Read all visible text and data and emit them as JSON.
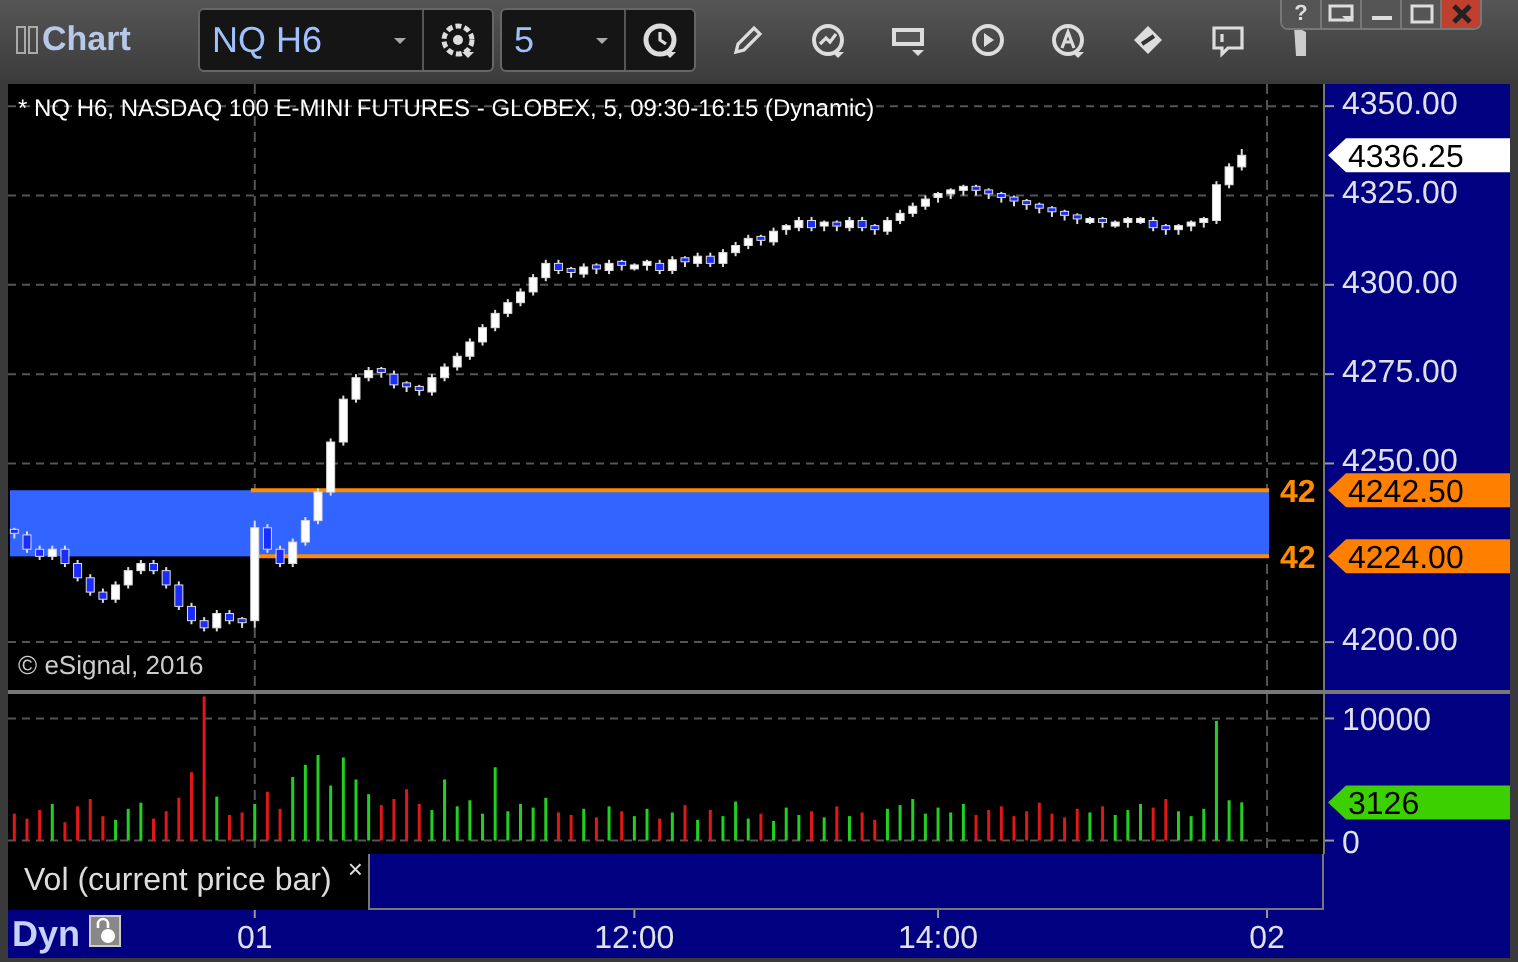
{
  "window": {
    "title": "Chart",
    "help_button": "?"
  },
  "toolbar": {
    "symbol": "NQ H6",
    "interval": "5"
  },
  "price_pane": {
    "title": "* NQ H6, NASDAQ 100 E-MINI FUTURES - GLOBEX, 5, 09:30-16:15 (Dynamic)",
    "copyright": "© eSignal, 2016",
    "last_price": "4336.25",
    "levels": [
      {
        "label": "42",
        "price": "4242.50"
      },
      {
        "label": "42",
        "price": "4224.00"
      }
    ],
    "chart_data": {
      "type": "candlestick",
      "grid": true,
      "ylim": [
        4186.6,
        4356.2
      ],
      "categories": [
        null,
        null,
        null,
        null,
        null,
        null,
        null,
        null,
        null,
        null,
        null,
        null,
        null,
        null,
        null,
        null,
        null,
        null,
        null,
        null,
        null,
        null,
        null,
        null,
        null,
        null,
        null,
        null,
        null,
        null,
        null,
        null,
        null,
        null,
        null,
        null,
        null,
        null,
        null,
        null,
        null,
        null,
        null,
        null,
        null,
        null,
        null,
        null,
        null,
        null,
        null,
        null,
        null,
        null,
        null,
        null,
        null,
        null,
        null,
        null,
        null,
        null,
        null,
        null,
        null,
        null,
        null,
        null,
        null,
        null,
        null,
        null,
        null,
        null,
        null,
        null,
        null,
        null,
        null,
        null,
        null,
        null,
        null,
        null,
        null,
        null,
        null,
        null,
        null,
        null,
        null,
        null,
        null,
        null,
        null,
        null,
        null,
        null,
        null,
        null,
        null,
        null,
        null,
        null
      ],
      "yticks": [
        {
          "value": 4350,
          "label": "4350.00"
        },
        {
          "value": 4325,
          "label": "4325.00"
        },
        {
          "value": 4300,
          "label": "4300.00"
        },
        {
          "value": 4275,
          "label": "4275.00"
        },
        {
          "value": 4250,
          "label": "4250.00"
        },
        {
          "value": 4200,
          "label": "4200.00"
        }
      ],
      "ohlc": [
        [
          4231,
          4232,
          4229,
          4230
        ],
        [
          4230,
          4231,
          4225,
          4226
        ],
        [
          4226,
          4227,
          4223,
          4224
        ],
        [
          4224,
          4227,
          4223,
          4226
        ],
        [
          4226,
          4227,
          4221,
          4222
        ],
        [
          4222,
          4223,
          4217,
          4218
        ],
        [
          4218,
          4219,
          4213,
          4214
        ],
        [
          4214,
          4215,
          4211,
          4212
        ],
        [
          4212,
          4217,
          4211,
          4216
        ],
        [
          4216,
          4221,
          4215,
          4220
        ],
        [
          4220,
          4223,
          4219,
          4222
        ],
        [
          4222,
          4223,
          4219,
          4220
        ],
        [
          4220,
          4221,
          4215,
          4216
        ],
        [
          4216,
          4217,
          4209,
          4210
        ],
        [
          4210,
          4211,
          4205,
          4206
        ],
        [
          4206,
          4207,
          4203,
          4204
        ],
        [
          4204,
          4209,
          4203,
          4208
        ],
        [
          4208,
          4209,
          4205,
          4206
        ],
        [
          4206,
          4207,
          4204,
          4205
        ],
        [
          4206,
          4234,
          4204,
          4232
        ],
        [
          4232,
          4233,
          4225,
          4226
        ],
        [
          4226,
          4227,
          4221,
          4222
        ],
        [
          4222,
          4229,
          4221,
          4228
        ],
        [
          4228,
          4235,
          4227,
          4234
        ],
        [
          4234,
          4243,
          4233,
          4242
        ],
        [
          4242,
          4257,
          4241,
          4256
        ],
        [
          4256,
          4269,
          4255,
          4268
        ],
        [
          4268,
          4275,
          4267,
          4274
        ],
        [
          4274,
          4277,
          4273,
          4276
        ],
        [
          4276,
          4277,
          4274,
          4275
        ],
        [
          4275,
          4276,
          4271,
          4272
        ],
        [
          4272,
          4273,
          4270,
          4271
        ],
        [
          4271,
          4272,
          4269,
          4270
        ],
        [
          4270,
          4275,
          4269,
          4274
        ],
        [
          4274,
          4278,
          4273,
          4277
        ],
        [
          4277,
          4281,
          4276,
          4280
        ],
        [
          4280,
          4285,
          4279,
          4284
        ],
        [
          4284,
          4289,
          4283,
          4288
        ],
        [
          4288,
          4293,
          4287,
          4292
        ],
        [
          4292,
          4296,
          4291,
          4295
        ],
        [
          4295,
          4299,
          4294,
          4298
        ],
        [
          4298,
          4303,
          4297,
          4302
        ],
        [
          4302,
          4307,
          4301,
          4306
        ],
        [
          4306,
          4307,
          4303,
          4304
        ],
        [
          4304,
          4305,
          4302,
          4303
        ],
        [
          4303,
          4306,
          4302,
          4305
        ],
        [
          4305,
          4306,
          4303,
          4304
        ],
        [
          4304,
          4307,
          4303,
          4306
        ],
        [
          4306,
          4307,
          4304,
          4305
        ],
        [
          4305,
          4306,
          4304,
          4305
        ],
        [
          4305,
          4307,
          4304,
          4306
        ],
        [
          4306,
          4307,
          4303,
          4304
        ],
        [
          4304,
          4308,
          4303,
          4307
        ],
        [
          4307,
          4308,
          4305,
          4306
        ],
        [
          4306,
          4309,
          4305,
          4308
        ],
        [
          4308,
          4309,
          4305,
          4306
        ],
        [
          4306,
          4310,
          4305,
          4309
        ],
        [
          4309,
          4312,
          4308,
          4311
        ],
        [
          4311,
          4314,
          4310,
          4313
        ],
        [
          4313,
          4314,
          4311,
          4312
        ],
        [
          4312,
          4316,
          4311,
          4315
        ],
        [
          4315,
          4317,
          4314,
          4316
        ],
        [
          4316,
          4319,
          4315,
          4318
        ],
        [
          4318,
          4319,
          4315,
          4316
        ],
        [
          4316,
          4318,
          4315,
          4317
        ],
        [
          4317,
          4318,
          4315,
          4316
        ],
        [
          4316,
          4319,
          4315,
          4318
        ],
        [
          4318,
          4319,
          4315,
          4316
        ],
        [
          4316,
          4317,
          4314,
          4315
        ],
        [
          4315,
          4319,
          4314,
          4318
        ],
        [
          4318,
          4321,
          4317,
          4320
        ],
        [
          4320,
          4323,
          4319,
          4322
        ],
        [
          4322,
          4325,
          4321,
          4324
        ],
        [
          4324,
          4326,
          4323,
          4325
        ],
        [
          4325,
          4327,
          4324,
          4326
        ],
        [
          4326,
          4328,
          4325,
          4327
        ],
        [
          4327,
          4328,
          4325,
          4326
        ],
        [
          4326,
          4327,
          4324,
          4325
        ],
        [
          4325,
          4326,
          4323,
          4324
        ],
        [
          4324,
          4325,
          4322,
          4323
        ],
        [
          4323,
          4324,
          4321,
          4322
        ],
        [
          4322,
          4323,
          4320,
          4321
        ],
        [
          4321,
          4322,
          4319,
          4320
        ],
        [
          4320,
          4321,
          4318,
          4319
        ],
        [
          4319,
          4320,
          4317,
          4318
        ],
        [
          4318,
          4319,
          4317,
          4318
        ],
        [
          4318,
          4319,
          4316,
          4317
        ],
        [
          4317,
          4318,
          4316,
          4317
        ],
        [
          4317,
          4319,
          4316,
          4318
        ],
        [
          4318,
          4319,
          4317,
          4318
        ],
        [
          4318,
          4319,
          4315,
          4316
        ],
        [
          4316,
          4317,
          4314,
          4315
        ],
        [
          4315,
          4317,
          4314,
          4316
        ],
        [
          4316,
          4318,
          4315,
          4317
        ],
        [
          4317,
          4319,
          4316,
          4318
        ],
        [
          4318,
          4329,
          4317,
          4328
        ],
        [
          4328,
          4334,
          4327,
          4333
        ],
        [
          4333,
          4338,
          4332,
          4336.25
        ],
        null,
        null,
        null,
        null,
        null,
        null
      ]
    }
  },
  "volume_pane": {
    "legend": "Vol (current price bar)",
    "close_glyph": "×",
    "last_value": "3126",
    "chart_data": {
      "type": "bar",
      "stacked": true,
      "grid": true,
      "ylim": [
        -1100,
        12000
      ],
      "yticks": [
        {
          "value": 10000,
          "label": "10000"
        },
        {
          "value": 0,
          "label": "0"
        }
      ],
      "categories": [
        null,
        null,
        null,
        null,
        null,
        null,
        null,
        null,
        null,
        null,
        null,
        null,
        null,
        null,
        null,
        null,
        null,
        null,
        null,
        "01",
        null,
        null,
        null,
        null,
        null,
        null,
        null,
        null,
        null,
        null,
        null,
        null,
        null,
        null,
        null,
        null,
        null,
        null,
        null,
        null,
        null,
        null,
        null,
        null,
        null,
        null,
        null,
        null,
        null,
        "12:00",
        null,
        null,
        null,
        null,
        null,
        null,
        null,
        null,
        null,
        null,
        null,
        null,
        null,
        null,
        null,
        null,
        null,
        null,
        null,
        null,
        null,
        null,
        null,
        "14:00",
        null,
        null,
        null,
        null,
        null,
        null,
        null,
        null,
        null,
        null,
        null,
        null,
        null,
        null,
        null,
        null,
        null,
        null,
        null,
        null,
        null,
        null,
        null,
        null,
        null,
        "02",
        null,
        null,
        null,
        null
      ],
      "series": [
        {
          "color": "#22d022",
          "values": [
            null,
            null,
            null,
            3000,
            null,
            null,
            null,
            null,
            1700,
            2600,
            3100,
            null,
            null,
            null,
            null,
            null,
            3600,
            null,
            null,
            3000,
            null,
            null,
            5200,
            6200,
            7000,
            4500,
            6800,
            5000,
            3800,
            null,
            null,
            null,
            null,
            2500,
            5000,
            2800,
            3300,
            2200,
            6000,
            2400,
            3000,
            2700,
            3500,
            null,
            null,
            2600,
            null,
            2800,
            null,
            2000,
            2600,
            null,
            2300,
            null,
            1700,
            null,
            2000,
            3200,
            1800,
            null,
            1600,
            2700,
            2100,
            null,
            1900,
            null,
            2000,
            null,
            null,
            2600,
            2900,
            3400,
            2200,
            2700,
            2300,
            3000,
            null,
            null,
            null,
            null,
            null,
            null,
            null,
            null,
            null,
            2300,
            null,
            2100,
            2500,
            3000,
            null,
            null,
            2400,
            2000,
            2600,
            9800,
            3300,
            3126,
            null,
            null,
            null,
            null,
            null,
            null
          ]
        },
        {
          "color": "#e01818",
          "values": [
            2200,
            1800,
            2500,
            null,
            1500,
            2800,
            3400,
            2000,
            null,
            null,
            null,
            1800,
            2400,
            3500,
            5600,
            11800,
            null,
            2100,
            2300,
            null,
            4000,
            2600,
            null,
            null,
            null,
            null,
            null,
            null,
            null,
            2900,
            3400,
            4200,
            3000,
            null,
            null,
            null,
            null,
            null,
            null,
            null,
            null,
            null,
            null,
            2300,
            2100,
            null,
            1900,
            null,
            2400,
            null,
            null,
            1800,
            null,
            2900,
            null,
            2500,
            null,
            null,
            null,
            2200,
            null,
            null,
            null,
            2400,
            null,
            2800,
            null,
            2300,
            1700,
            null,
            null,
            null,
            null,
            null,
            null,
            null,
            2100,
            2500,
            2800,
            2000,
            2400,
            3100,
            2200,
            1900,
            2600,
            null,
            2800,
            null,
            null,
            null,
            2700,
            3400,
            null,
            null,
            null,
            null,
            null,
            null,
            null,
            null,
            null,
            null,
            null,
            null
          ]
        }
      ]
    }
  },
  "time_axis": {
    "mode": "Dyn"
  }
}
